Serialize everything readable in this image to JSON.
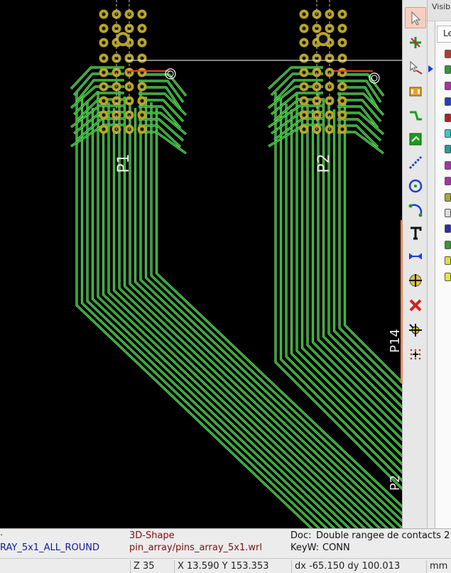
{
  "canvas": {
    "footprint_labels": [
      "P1",
      "P2"
    ],
    "edge_labels": [
      "P14",
      "P2"
    ],
    "colors": {
      "background": "#000000",
      "track": "#1a9d1a",
      "track_outline": "#7fe07f",
      "pad": "#b9a42a",
      "pad_hole": "#0f1a0f",
      "cursor_line": "#ffffff",
      "highlight": "#e04a1a"
    }
  },
  "right_toolbar": {
    "tools": [
      {
        "name": "select-tool",
        "icon": "arrow-cursor-icon",
        "active": true
      },
      {
        "name": "highlight-net-tool",
        "icon": "net-highlight-icon",
        "active": false
      },
      {
        "name": "local-ratsnest-tool",
        "icon": "ratsnest-cursor-icon",
        "active": false
      },
      {
        "name": "add-footprint-tool",
        "icon": "footprint-icon",
        "active": false
      },
      {
        "name": "route-tracks-tool",
        "icon": "route-track-icon",
        "active": false
      },
      {
        "name": "add-zone-tool",
        "icon": "zone-icon",
        "active": false
      },
      {
        "name": "add-line-tool",
        "icon": "dashed-line-icon",
        "active": false
      },
      {
        "name": "add-circle-tool",
        "icon": "circle-icon",
        "active": false
      },
      {
        "name": "add-arc-tool",
        "icon": "arc-icon",
        "active": false
      },
      {
        "name": "add-text-tool",
        "icon": "text-icon",
        "active": false
      },
      {
        "name": "add-dimension-tool",
        "icon": "dimension-icon",
        "active": false
      },
      {
        "name": "add-target-tool",
        "icon": "target-icon",
        "active": false
      },
      {
        "name": "delete-tool",
        "icon": "delete-cross-icon",
        "active": false
      },
      {
        "name": "set-origin-tool",
        "icon": "origin-icon",
        "active": false
      },
      {
        "name": "grid-origin-tool",
        "icon": "grid-origin-icon",
        "active": false
      }
    ]
  },
  "layers_panel": {
    "header": "Visib",
    "tab": "Le",
    "layer_colors": [
      "#c0392b",
      "#2aa02a",
      "#b52ab5",
      "#1f3fcf",
      "#c01a1a",
      "#2ad0d0",
      "#1aa0a0",
      "#b52ab5",
      "#b52ab5",
      "#a8a82a",
      "#dcdcdc",
      "#2a2ab5",
      "#2aa02a",
      "#e0e02a",
      "#e8e82a"
    ],
    "active_row": 1
  },
  "status": {
    "left_fragment": "RAY_5x1_ALL_ROUND",
    "shape_label": "3D-Shape",
    "shape_value": "pin_array/pins_array_5x1.wrl",
    "doc_label": "Doc:",
    "doc_value": "Double rangee de contacts 2",
    "keyw_label": "KeyW:",
    "keyw_value": "CONN",
    "zoom": "Z 35",
    "xy": "X 13.590  Y 153.353",
    "dxdy": "dx -65.150  dy 100.013",
    "units": "mm"
  }
}
